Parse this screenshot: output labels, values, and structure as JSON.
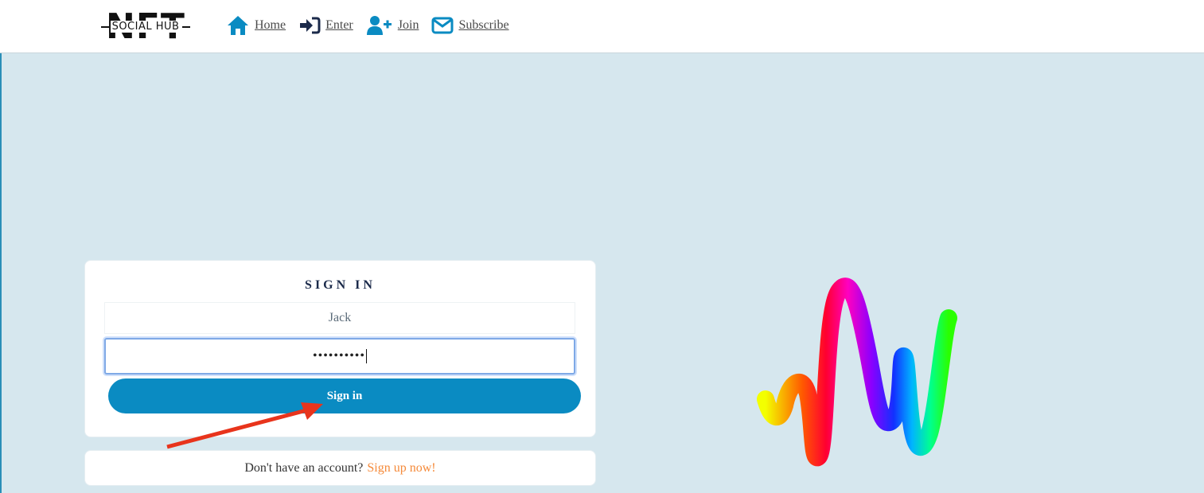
{
  "logo": {
    "title": "NFT",
    "subtitle": "SOCIAL HUB"
  },
  "nav": [
    {
      "label": "Home",
      "icon": "home-icon"
    },
    {
      "label": "Enter",
      "icon": "sign-in-icon"
    },
    {
      "label": "Join",
      "icon": "user-plus-icon"
    },
    {
      "label": "Subscribe",
      "icon": "envelope-icon"
    }
  ],
  "signin": {
    "title": "SIGN IN",
    "username_value": "Jack",
    "password_value": "••••••••••",
    "button_label": "Sign in"
  },
  "signup": {
    "prompt": "Don't have an account?",
    "link": "Sign up now!"
  },
  "colors": {
    "background": "#d6e7ee",
    "accent": "#0a8bc2",
    "link": "#f58a3a",
    "annotation_arrow": "#e8341c"
  }
}
